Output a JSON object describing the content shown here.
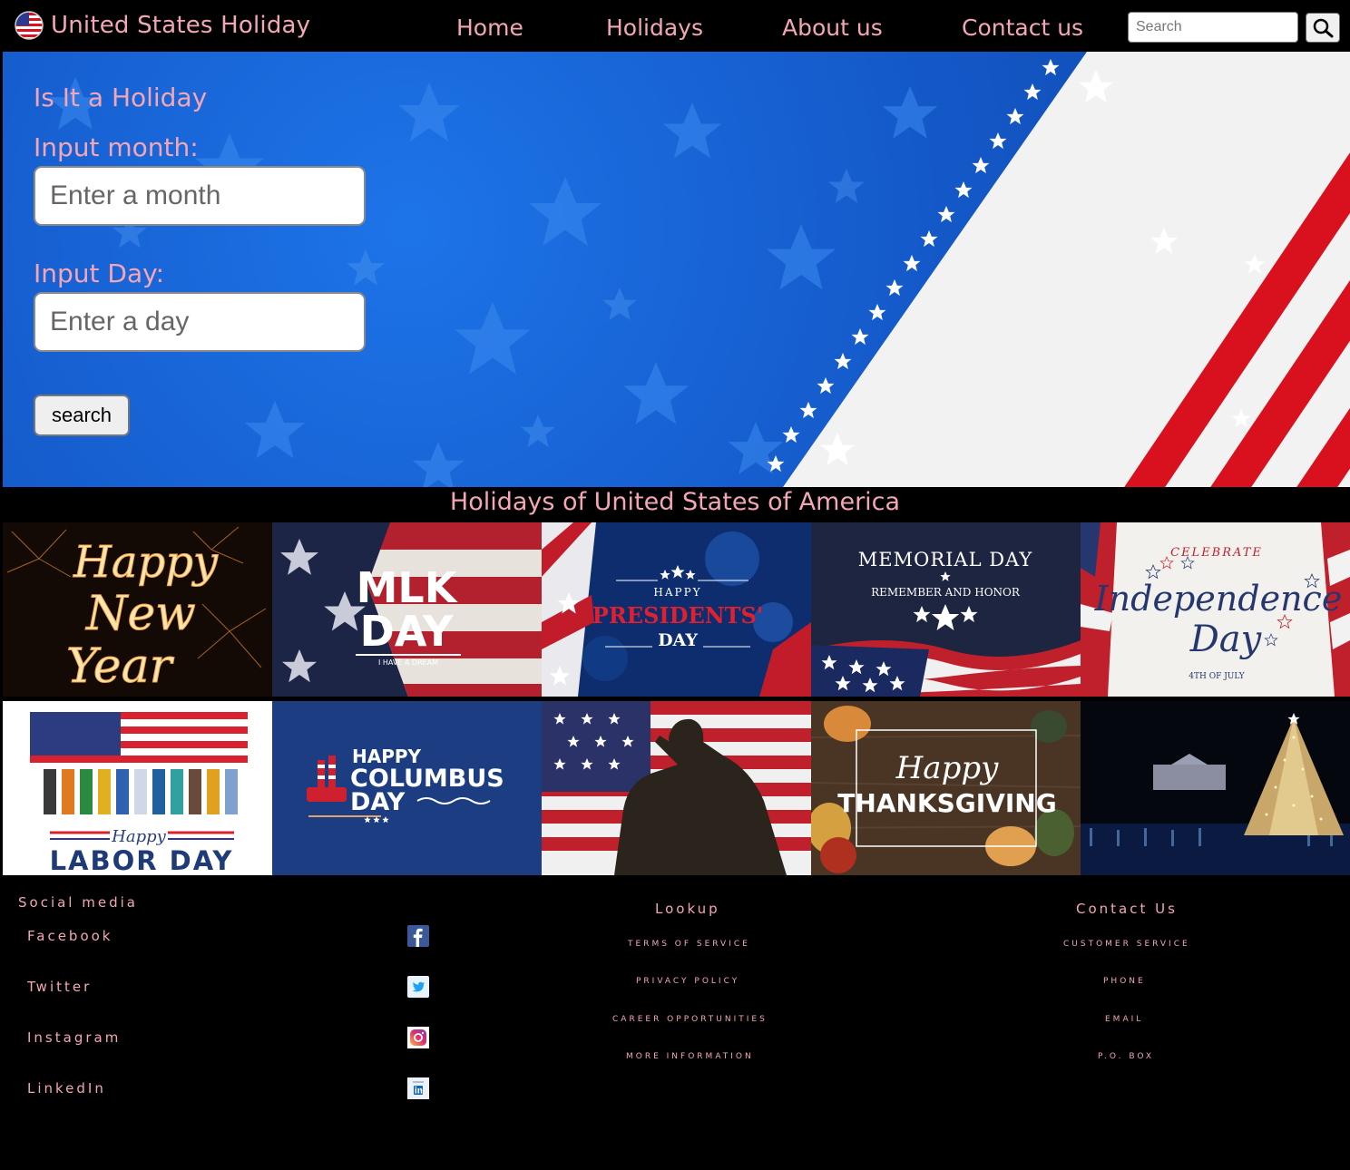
{
  "header": {
    "title": "United States Holiday",
    "nav": [
      "Home",
      "Holidays",
      "About us",
      "Contact us"
    ],
    "search_placeholder": "Search"
  },
  "hero": {
    "heading": "Is It a Holiday",
    "month_label": "Input month:",
    "month_placeholder": "Enter a month",
    "day_label": "Input Day:",
    "day_placeholder": "Enter a day",
    "button_label": "search"
  },
  "section_title": "Holidays of United States of America",
  "holidays": [
    {
      "lines": [
        "Happy",
        "New",
        "Year"
      ]
    },
    {
      "lines": [
        "MLK",
        "DAY",
        "I HAVE A DREAM"
      ]
    },
    {
      "lines": [
        "HAPPY",
        "PRESIDENTS'",
        "DAY"
      ]
    },
    {
      "lines": [
        "MEMORIAL DAY",
        "REMEMBER AND HONOR"
      ]
    },
    {
      "lines": [
        "CELEBRATE",
        "Independence",
        "Day",
        "4TH OF JULY"
      ]
    },
    {
      "lines": [
        "Happy",
        "LABOR DAY"
      ]
    },
    {
      "lines": [
        "HAPPY",
        "COLUMBUS",
        "DAY"
      ]
    },
    {
      "lines": []
    },
    {
      "lines": [
        "Happy",
        "THANKSGIVING"
      ]
    },
    {
      "lines": []
    }
  ],
  "footer": {
    "social_heading": "Social media",
    "social": [
      "Facebook",
      "Twitter",
      "Instagram",
      "LinkedIn"
    ],
    "lookup_heading": "Lookup",
    "lookup": [
      "TERMS OF SERVICE",
      "PRIVACY POLICY",
      "CAREER OPPORTUNITIES",
      "MORE INFORMATION"
    ],
    "contact_heading": "Contact Us",
    "contact": [
      "CUSTOMER SERVICE",
      "PHONE",
      "EMAIL",
      "P.O. BOX"
    ]
  },
  "colors": {
    "accent": "#f4a6b5",
    "background": "#000000",
    "hero_blue": "#1458c8",
    "flag_red": "#d9101e"
  },
  "icons": [
    "us-flag-icon",
    "magnifier-icon",
    "facebook-icon",
    "twitter-icon",
    "instagram-icon",
    "linkedin-icon"
  ]
}
